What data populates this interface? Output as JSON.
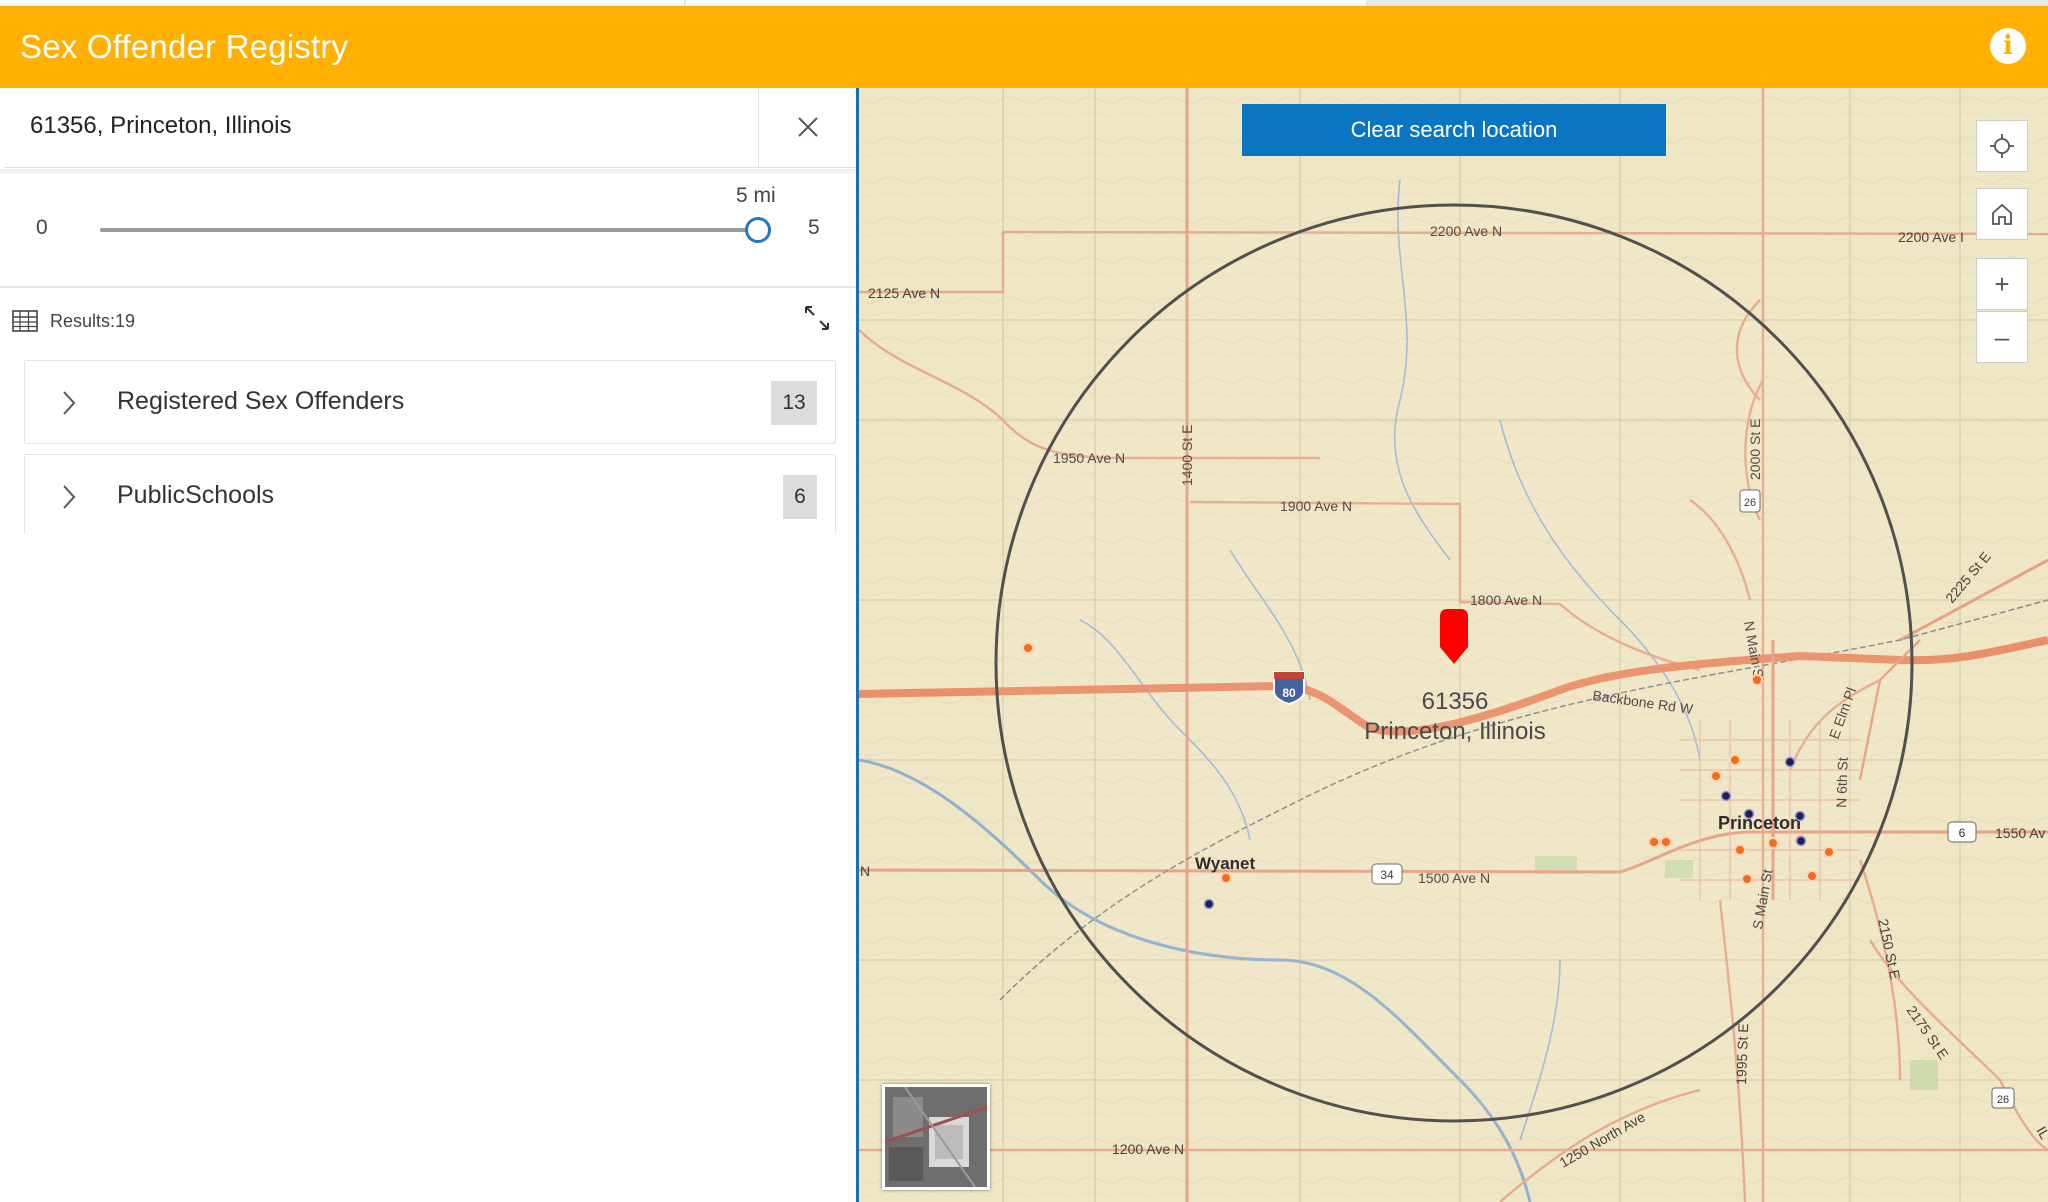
{
  "app": {
    "title": "Sex Offender Registry",
    "info_icon": "info-icon"
  },
  "search": {
    "value": "61356, Princeton, Illinois",
    "clear_icon": "close-icon"
  },
  "buffer_slider": {
    "min_label": "0",
    "max_label": "5",
    "current_label": "5 mi",
    "min": 0,
    "max": 5,
    "value": 5,
    "unit": "mi"
  },
  "results": {
    "label": "Results:19",
    "icon": "table-icon",
    "expand_icon": "expand-icon"
  },
  "layers": [
    {
      "name": "Registered Sex Offenders",
      "count": "13"
    },
    {
      "name": "PublicSchools",
      "count": "6"
    }
  ],
  "map": {
    "clear_button": "Clear search location",
    "controls": [
      "locate-icon",
      "home-icon",
      "zoom-in-icon",
      "zoom-out-icon"
    ],
    "zoom_in": "+",
    "zoom_out": "–",
    "pin_zip": "61356",
    "pin_place": "Princeton, Illinois",
    "buffer_radius_mi": 5,
    "labels": {
      "road_2200": "2200 Ave N",
      "road_2200_right": "2200 Ave I",
      "road_2125": "2125 Ave N",
      "road_1950": "1950 Ave N",
      "road_1900": "1900 Ave N",
      "road_1800": "1800 Ave N",
      "road_1500": "1500 Ave N",
      "road_1550": "1550 Av",
      "road_1200": "1200 Ave N",
      "road_1250": "1250 North Ave",
      "road_1400": "1400 St E",
      "road_2000": "2000 St E",
      "road_2225": "2225 St E",
      "road_2150": "2150 St E",
      "road_2175": "2175 St E",
      "road_1995": "1995 St E",
      "road_backbone": "Backbone Rd W",
      "road_nmain": "N Main St",
      "road_smain": "S Main St",
      "road_n6th": "N 6th St",
      "road_elm": "E Elm Pl",
      "edge_n": "N",
      "edge_il": "IL",
      "town_wyanet": "Wyanet",
      "town_princeton": "Princeton",
      "shield_i80": "80",
      "shield_26a": "26",
      "shield_26b": "26",
      "shield_34": "34",
      "shield_6": "6"
    },
    "colors": {
      "offender_marker": "#f06d1f",
      "school_marker": "#1e1e5a",
      "pin": "#ff0000",
      "buffer": "#505050"
    }
  }
}
